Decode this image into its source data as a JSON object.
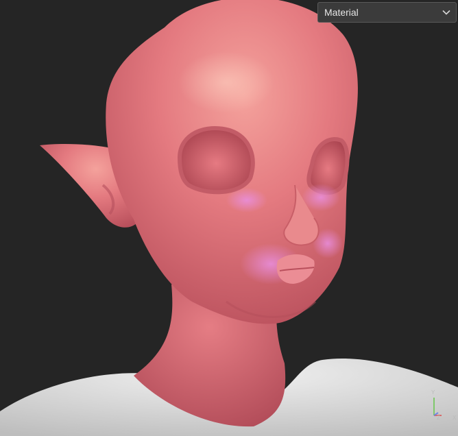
{
  "material_dropdown": {
    "selected": "Material",
    "icon": "chevron-down-icon"
  },
  "viewport": {
    "background": "#252525",
    "skin_color": "#e0707a",
    "blush_color": "#e08ad8",
    "shirt_color": "#d9d9d9"
  },
  "axis_gizmo": {
    "y_label": "Y",
    "z_label": "Z",
    "x_label": "X",
    "y_color": "#7ec86a",
    "z_color": "#6f86e0",
    "x_color": "#d86a6a"
  }
}
